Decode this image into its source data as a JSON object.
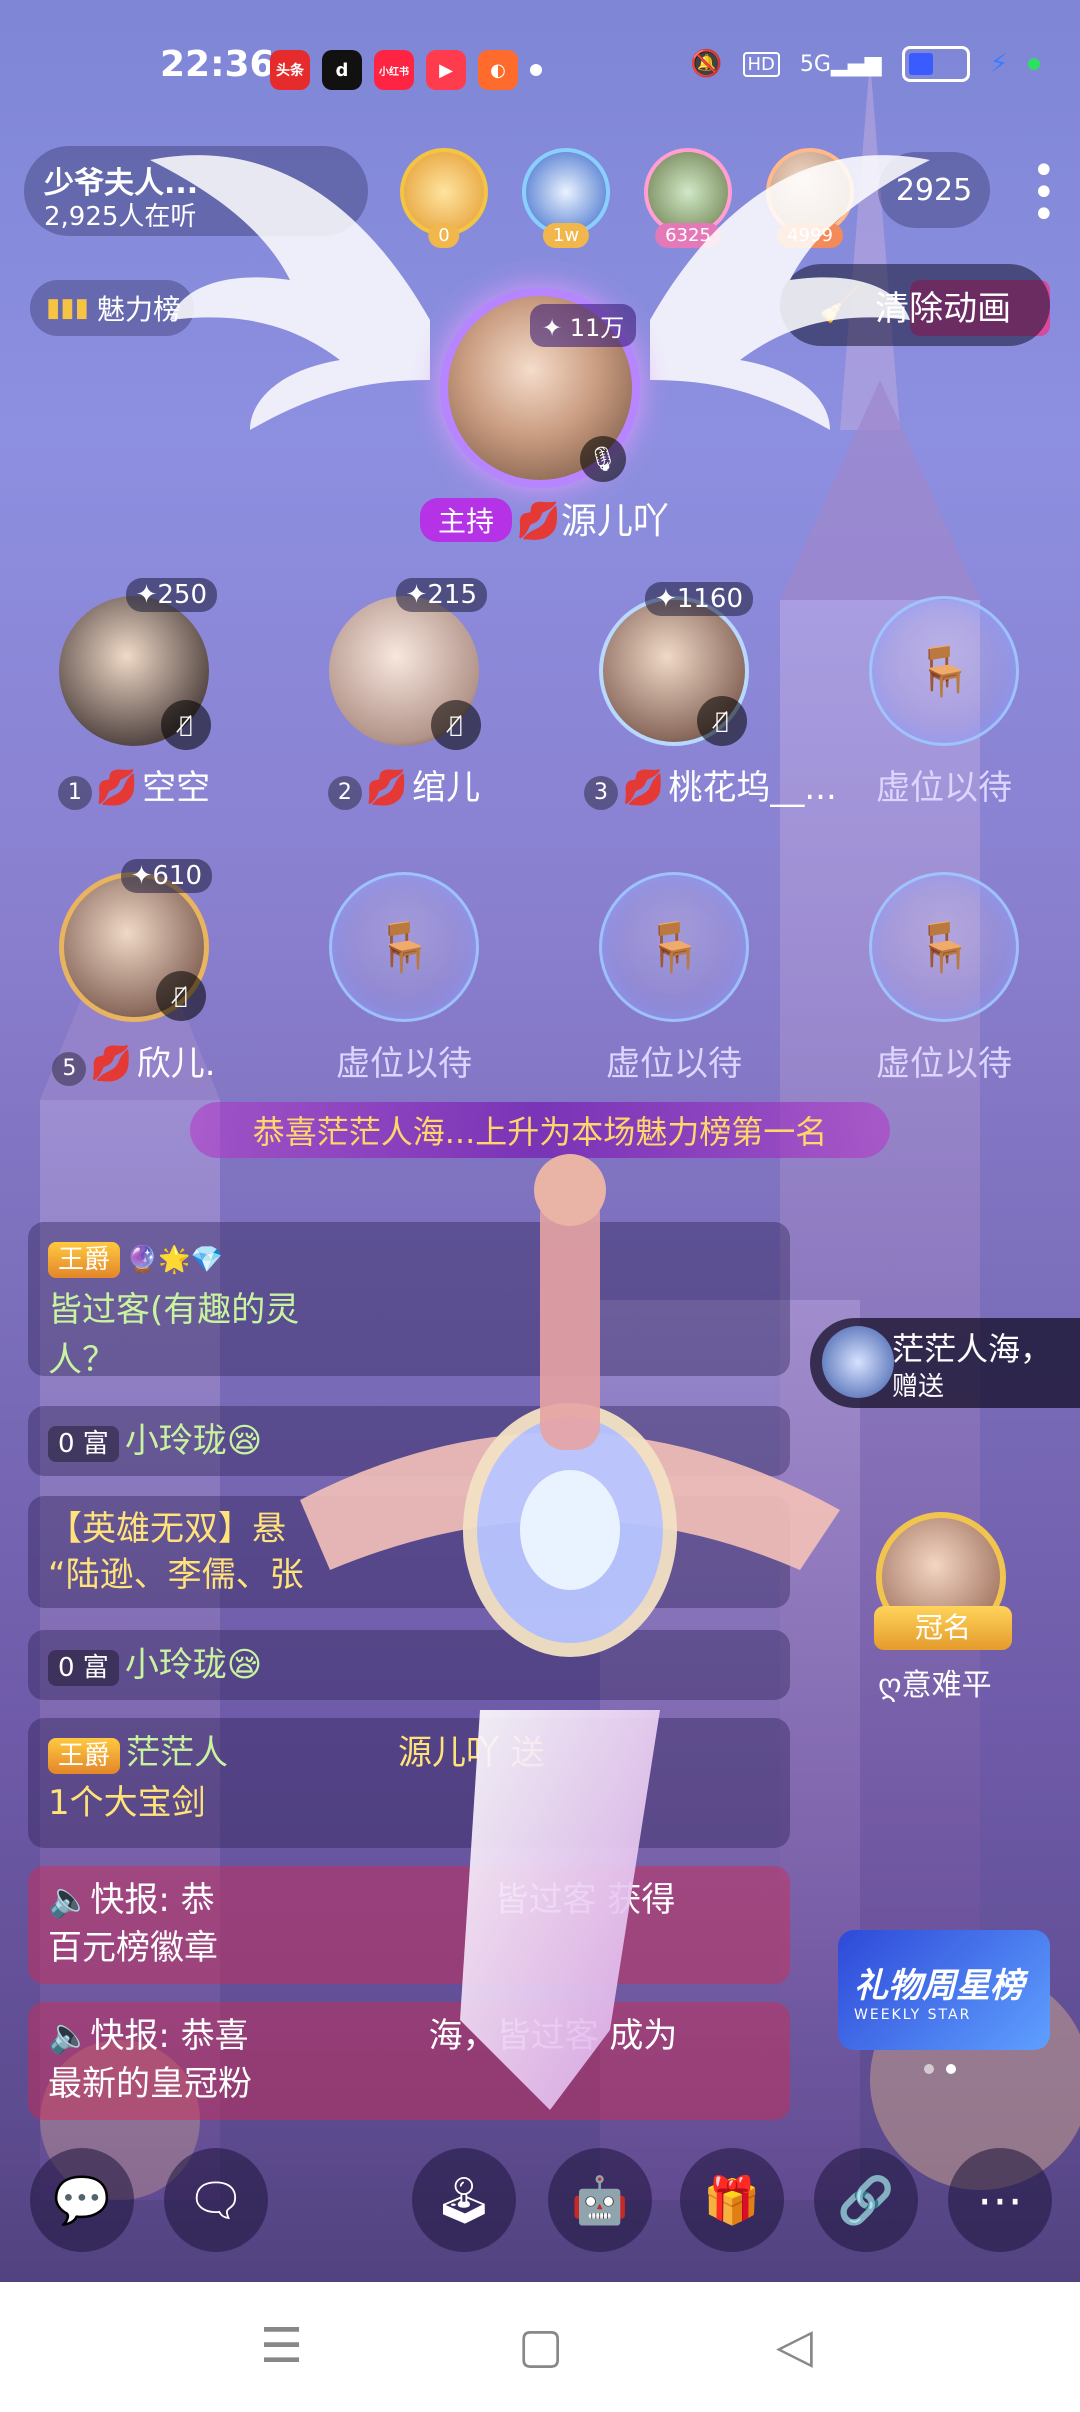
{
  "status_bar": {
    "time": "22:36",
    "app_icons": [
      "头条",
      "d",
      "小红书",
      "▶",
      "◐"
    ],
    "network": "5G",
    "hd": "HD"
  },
  "room": {
    "title": "少爷夫人...",
    "listeners": "2,925人在听",
    "online_count": "2925"
  },
  "top_contributors": [
    {
      "count": "0"
    },
    {
      "count": "1w"
    },
    {
      "count": "6325"
    },
    {
      "count": "4999"
    }
  ],
  "charm_board_label": "魅力榜",
  "clear_animation_label": "清除动画",
  "host": {
    "score": "11万",
    "badge": "主持",
    "name": "源儿吖"
  },
  "seats": [
    {
      "num": "1",
      "name": "空空",
      "score": "250"
    },
    {
      "num": "2",
      "name": "绾儿",
      "score": "215"
    },
    {
      "num": "3",
      "name": "桃花坞__...",
      "score": "1160"
    },
    {
      "num": "",
      "name": "虚位以待",
      "score": ""
    },
    {
      "num": "5",
      "name": "欣儿.",
      "score": "610"
    },
    {
      "num": "",
      "name": "虚位以待",
      "score": ""
    },
    {
      "num": "",
      "name": "虚位以待",
      "score": ""
    },
    {
      "num": "",
      "name": "虚位以待",
      "score": ""
    }
  ],
  "congrats_banner": "恭喜茫茫人海...上升为本场魅力榜第一名",
  "chat": [
    {
      "badge": "王爵",
      "text": "皆过客(有趣的灵",
      "text2": "人？"
    },
    {
      "badge": "0 富",
      "user": "小玲珑😪",
      "text": ""
    },
    {
      "badge": "",
      "text": "【英雄无双】悬",
      "text2": "“陆逊、李儒、张"
    },
    {
      "badge": "0 富",
      "user": "小玲珑😪",
      "text": ""
    },
    {
      "badge": "王爵",
      "user": "茫茫人",
      "text": "源儿吖 送",
      "text2": "1个大宝剑"
    },
    {
      "badge": "",
      "text": "🔈快报: 恭",
      "text_b": "皆过客 获得",
      "text2": "百元榜徽章"
    },
    {
      "badge": "",
      "text": "🔈快报: 恭喜",
      "text_b": "海，皆过客 成为",
      "text2": "最新的皇冠粉"
    }
  ],
  "gift_toast": {
    "name": "茫茫人海，",
    "sub": "赠送"
  },
  "crown": {
    "badge": "冠名",
    "name": "ღ意难平"
  },
  "weekly_star": {
    "title": "礼物周星榜",
    "subtitle": "WEEKLY STAR"
  },
  "toolbar": {
    "items": [
      "chat-bubble",
      "comment",
      "game",
      "robot",
      "gift",
      "link",
      "more"
    ]
  },
  "colors": {
    "accent": "#b532e7",
    "gold": "#f0c44f",
    "chat_red": "#d22850"
  }
}
